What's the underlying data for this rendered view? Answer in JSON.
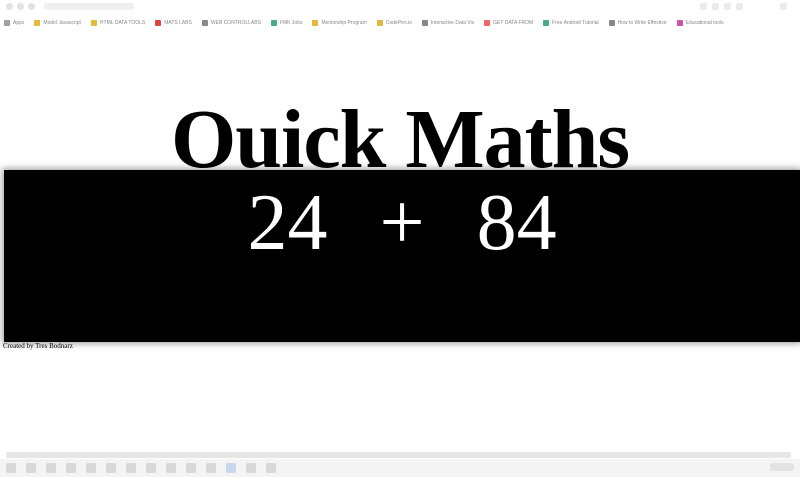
{
  "bookmarks": [
    {
      "label": "Apps",
      "color": "#9aa0a6"
    },
    {
      "label": "Model Javascript",
      "color": "#e2b93b"
    },
    {
      "label": "HTML DATA TOOLS",
      "color": "#e2b93b"
    },
    {
      "label": "MATS LABS",
      "color": "#d44"
    },
    {
      "label": "WEB CONTROLLABS",
      "color": "#888"
    },
    {
      "label": "FMK Jobs",
      "color": "#4a8"
    },
    {
      "label": "Mentorship Program",
      "color": "#e2b93b"
    },
    {
      "label": "CodePen.io",
      "color": "#e2b93b"
    },
    {
      "label": "Interactive Data Vis",
      "color": "#888"
    },
    {
      "label": "GET DATA FROM",
      "color": "#e66"
    },
    {
      "label": "Free Android Tutorial",
      "color": "#4a8"
    },
    {
      "label": "How to Write Effective",
      "color": "#888"
    },
    {
      "label": "Educational tools",
      "color": "#c5a"
    }
  ],
  "page": {
    "title": "Ouick Maths",
    "equation": {
      "left": "24",
      "operator": "+",
      "right": "84"
    },
    "credit": "Created by Tres Bodnarz"
  },
  "taskbar_items": 14
}
